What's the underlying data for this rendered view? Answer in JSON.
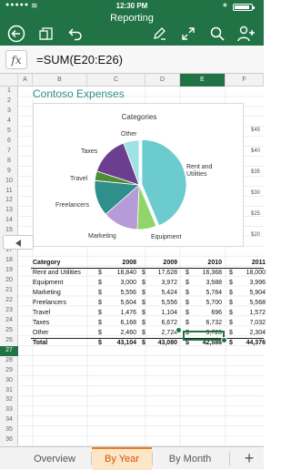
{
  "status": {
    "time": "12:30 PM",
    "signal": "●●●●●",
    "wifi": "wifi-icon"
  },
  "header": {
    "title": "Reporting",
    "toolbar": [
      "back-icon",
      "share-icon",
      "undo-icon",
      "edit-pencil-icon",
      "fullscreen-icon",
      "search-icon",
      "add-person-icon"
    ]
  },
  "formula": {
    "fx_label": "fx",
    "value": "=SUM(E20:E26)"
  },
  "columns": [
    {
      "label": "A"
    },
    {
      "label": "B"
    },
    {
      "label": "C"
    },
    {
      "label": "D"
    },
    {
      "label": "E",
      "active": true
    },
    {
      "label": "F"
    }
  ],
  "rows": [
    "1",
    "2",
    "3",
    "4",
    "5",
    "6",
    "7",
    "8",
    "9",
    "10",
    "11",
    "12",
    "13",
    "14",
    "15",
    "16",
    "17",
    "18",
    "19",
    "20",
    "21",
    "22",
    "23",
    "24",
    "25",
    "26",
    "27",
    "28",
    "29",
    "30",
    "31",
    "32",
    "33",
    "34",
    "35",
    "36"
  ],
  "active_row": "27",
  "sheet": {
    "title": "Contoso Expenses"
  },
  "chart_data": {
    "type": "pie",
    "title": "Categories",
    "categories": [
      "Rent and Utilities",
      "Equipment",
      "Marketing",
      "Freelancers",
      "Travel",
      "Taxes",
      "Other"
    ],
    "values": [
      18840,
      3000,
      5556,
      5604,
      1476,
      6168,
      2460
    ],
    "colors": [
      "#6ccbcf",
      "#8fd56a",
      "#b79ad8",
      "#2e8f8c",
      "#4e8c35",
      "#6b3e8f",
      "#9fe2e6"
    ],
    "legend_labels": {
      "rent": "Rent and\nUtilities",
      "equipment": "Equipment",
      "marketing": "Marketing",
      "freelancers": "Freelancers",
      "travel": "Travel",
      "taxes": "Taxes",
      "other": "Other"
    }
  },
  "axis_peek": [
    "$45",
    "$40",
    "$35",
    "$30",
    "$25",
    "$20"
  ],
  "table": {
    "headers": [
      "Category",
      "2008",
      "2009",
      "2010",
      "2011"
    ],
    "rows": [
      {
        "name": "Rent and Utilities",
        "v": [
          "18,840",
          "17,628",
          "16,368",
          "18,000"
        ]
      },
      {
        "name": "Equipment",
        "v": [
          "3,000",
          "3,972",
          "3,588",
          "3,996"
        ]
      },
      {
        "name": "Marketing",
        "v": [
          "5,556",
          "5,424",
          "5,784",
          "5,904"
        ]
      },
      {
        "name": "Freelancers",
        "v": [
          "5,604",
          "5,556",
          "5,700",
          "5,568"
        ]
      },
      {
        "name": "Travel",
        "v": [
          "1,476",
          "1,104",
          "696",
          "1,572"
        ]
      },
      {
        "name": "Taxes",
        "v": [
          "6,168",
          "6,672",
          "6,732",
          "7,032"
        ]
      },
      {
        "name": "Other",
        "v": [
          "2,460",
          "2,724",
          "3,720",
          "2,304"
        ]
      }
    ],
    "total": {
      "name": "Total",
      "v": [
        "43,104",
        "43,080",
        "42,588",
        "44,376"
      ]
    },
    "currency": "$"
  },
  "tabs": [
    {
      "label": "Overview",
      "active": false
    },
    {
      "label": "By Year",
      "active": true
    },
    {
      "label": "By Month",
      "active": false
    }
  ],
  "add_tab_label": "+"
}
